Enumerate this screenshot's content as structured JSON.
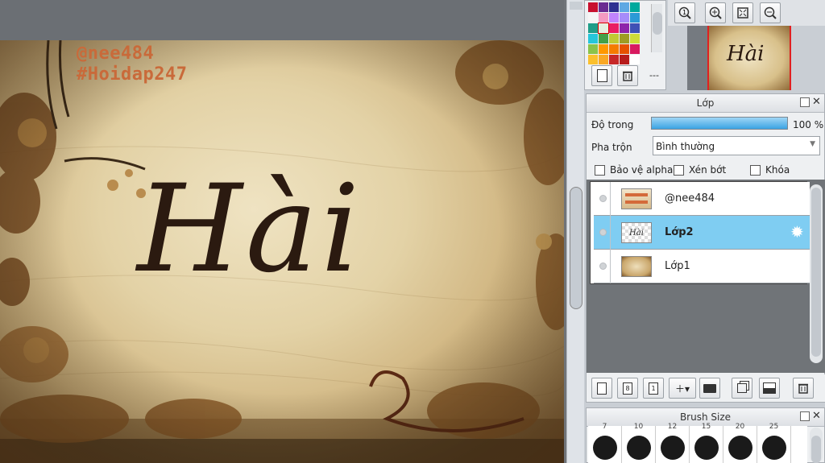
{
  "canvas": {
    "watermark_line1": "@nee484",
    "watermark_line2": "#Hoidap247",
    "artwork_text": "Hài"
  },
  "palette": {
    "colors": [
      "#c8102e",
      "#6a2c91",
      "#2e3192",
      "#5fa8e3",
      "#00a99d",
      "#f5f5f5",
      "#f49ac1",
      "#c084fc",
      "#a78bfa",
      "#2c9ad6",
      "#1f9e89",
      "#e5efe0",
      "#e91e63",
      "#8e24aa",
      "#3f51b5",
      "#26c6da",
      "#43a047",
      "#c0ca33",
      "#9e9d24",
      "#cddc39",
      "#8bc34a",
      "#ff9800",
      "#f57c00",
      "#e65100",
      "#d81b60",
      "#fbc02d",
      "#f9a825",
      "#c62828",
      "#b71c1c",
      "#ffffff"
    ],
    "new_icon": "new-page-icon",
    "delete_icon": "trash-icon",
    "more_label": "---"
  },
  "navigator": {
    "zoom_reset_icon": "zoom-reset-icon",
    "zoom_in_icon": "zoom-in-icon",
    "fit_icon": "fit-screen-icon",
    "zoom_out_icon": "zoom-out-icon",
    "preview_text": "Hài"
  },
  "layers_panel": {
    "title": "Lớp",
    "opacity_label": "Độ trong",
    "opacity_value": "100 %",
    "opacity_fraction": 1.0,
    "blend_label": "Pha trộn",
    "blend_value": "Bình thường",
    "protect_alpha_label": "Bảo vệ alpha",
    "clipping_label": "Xén bớt",
    "lock_label": "Khóa",
    "layers": [
      {
        "name": "@nee484",
        "selected": false
      },
      {
        "name": "Lớp2",
        "selected": true
      },
      {
        "name": "Lớp1",
        "selected": false
      }
    ]
  },
  "brush_panel": {
    "title": "Brush Size",
    "sizes": [
      "7",
      "10",
      "12",
      "15",
      "20",
      "25"
    ]
  },
  "colors": {
    "selected_layer": "#7fcdf2",
    "opacity_bar": "#4aaee8",
    "ink": "#2b1a10"
  }
}
